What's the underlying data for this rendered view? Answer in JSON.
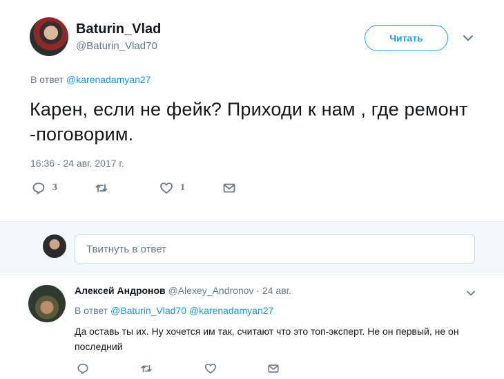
{
  "tweet": {
    "display_name": "Baturin_Vlad",
    "screen_name": "@Baturin_Vlad70",
    "follow_label": "Читать",
    "reply_to_prefix": "В ответ",
    "reply_to_mention": "@karenadamyan27",
    "text": "Карен, если не фейк? Приходи к нам  , где ремонт -поговорим.",
    "timestamp": "16:36 - 24 авг. 2017 г.",
    "actions": {
      "reply_icon": "reply-icon",
      "reply_count": "3",
      "retweet_icon": "retweet-icon",
      "like_icon": "heart-icon",
      "like_count": "1",
      "dm_icon": "envelope-icon"
    }
  },
  "compose": {
    "placeholder": "Твитнуть в ответ"
  },
  "reply": {
    "name": "Алексей Андронов",
    "handle_date": "@Alexey_Andronov · 24 авг.",
    "reply_to_prefix": "В ответ",
    "reply_to_mentions": "@Baturin_Vlad70 @karenadamyan27",
    "text": "Да оставь ты их. Ну хочется им так, считают что это топ-эксперт. Не он первый, не он последний"
  },
  "colors": {
    "accent": "#1da1f2",
    "link": "#1b95e0",
    "secondary_text": "#657786",
    "compose_bg": "#f5f8fa"
  }
}
